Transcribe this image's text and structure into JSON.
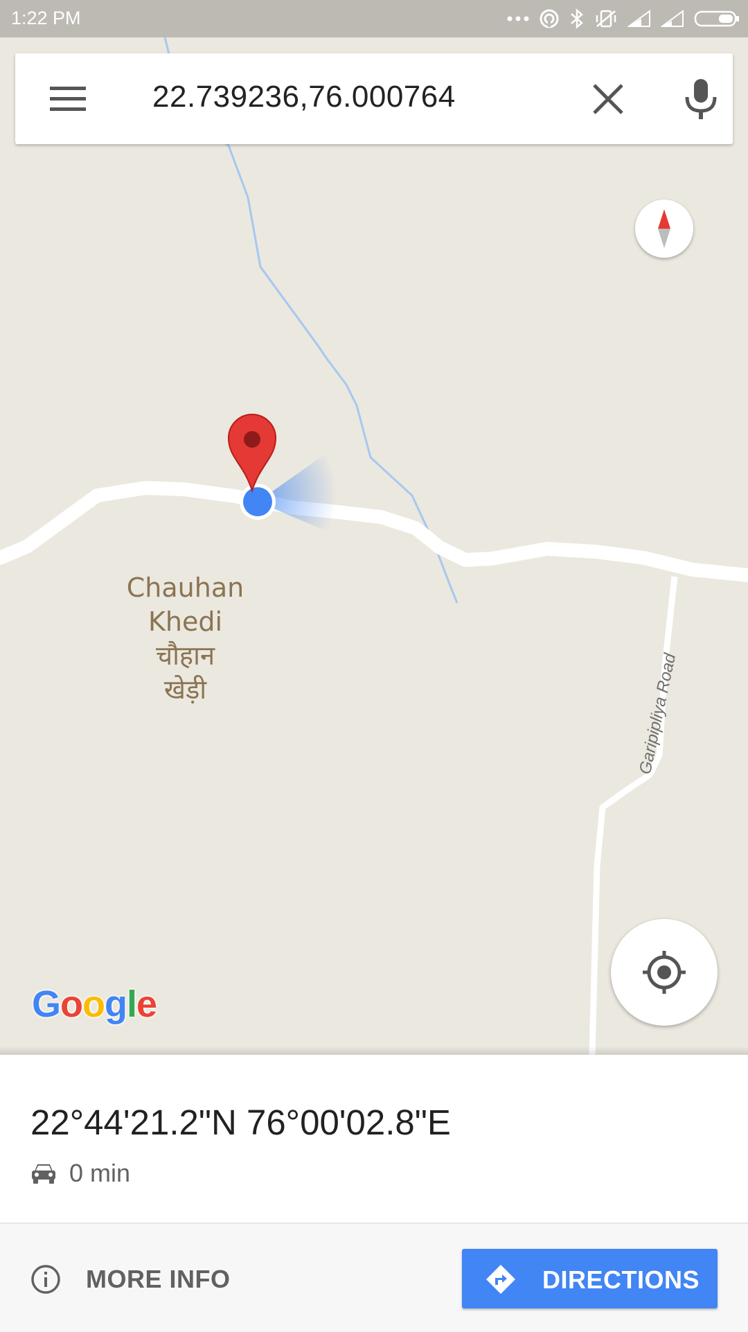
{
  "status_bar": {
    "time": "1:22 PM",
    "icons": [
      "more-dots-icon",
      "hotspot-icon",
      "bluetooth-icon",
      "vibrate-off-icon",
      "signal-icon",
      "signal-icon",
      "battery-icon"
    ]
  },
  "search": {
    "query": "22.739236,76.000764",
    "menu_icon": "menu-icon",
    "clear_icon": "close-icon",
    "mic_icon": "mic-icon"
  },
  "map": {
    "place_label": {
      "line1": "Chauhan",
      "line2": "Khedi",
      "line3": "चौहान",
      "line4": "खेड़ी"
    },
    "road_label": "Garipipliya Road",
    "logo": {
      "g1": "G",
      "o1": "o",
      "o2": "o",
      "g2": "g",
      "l": "l",
      "e": "e"
    },
    "colors": {
      "land": "#ebe8df",
      "road": "#ffffff",
      "water": "#a6c8f0",
      "pin": "#e53935",
      "location_dot": "#4285f4"
    }
  },
  "place_sheet": {
    "coordinates": "22°44'21.2\"N 76°00'02.8\"E",
    "eta": "0 min",
    "more_info_label": "MORE INFO",
    "directions_label": "DIRECTIONS"
  }
}
